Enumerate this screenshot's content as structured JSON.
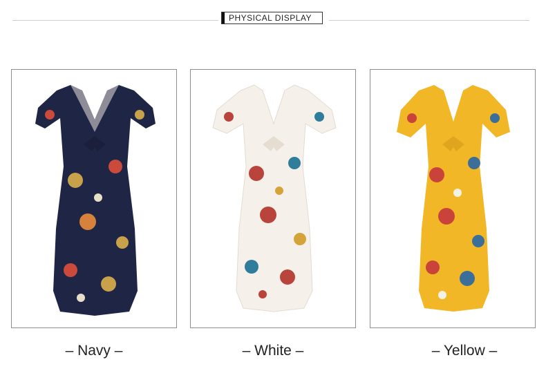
{
  "header": {
    "title": "PHYSICAL DISPLAY"
  },
  "variants": [
    {
      "label": "– Navy –",
      "color_name": "navy",
      "dress_color": "#1f2545",
      "accent": "#c8a24a"
    },
    {
      "label": "– White –",
      "color_name": "white",
      "dress_color": "#f5f0ea",
      "accent": "#b9443b"
    },
    {
      "label": "– Yellow –",
      "color_name": "yellow",
      "dress_color": "#f1b727",
      "accent": "#c9433b"
    }
  ]
}
